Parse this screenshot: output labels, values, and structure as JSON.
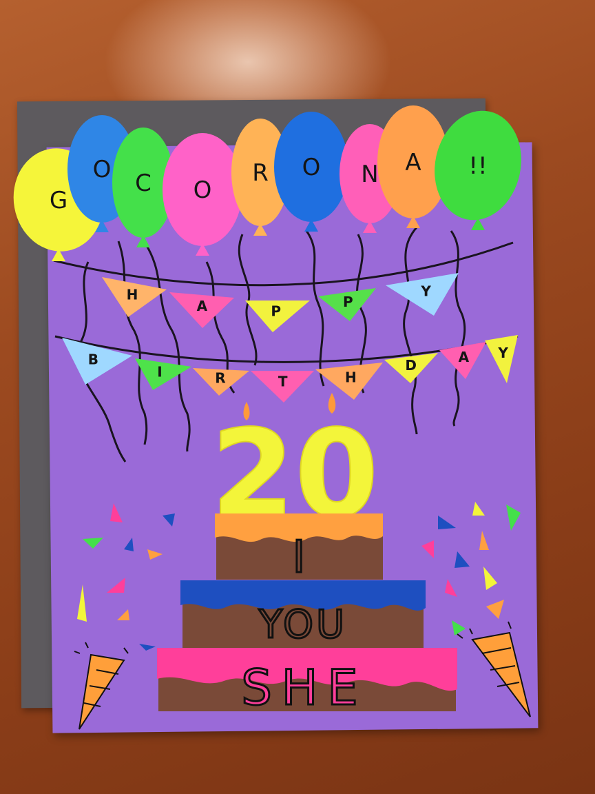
{
  "balloon_banner": {
    "letters": [
      "G",
      "O",
      "C",
      "O",
      "R",
      "O",
      "N",
      "A",
      "!!"
    ],
    "colors": [
      "#f5f53a",
      "#2f86e6",
      "#44e04a",
      "#ff62c8",
      "#ffb356",
      "#1f6fe0",
      "#ff5fb8",
      "#ffa04d",
      "#3fdc3f"
    ]
  },
  "bunting_row_1": {
    "letters": [
      "H",
      "A",
      "P",
      "P",
      "Y"
    ],
    "colors": [
      "#ffb46a",
      "#ff5fb0",
      "#f2f23e",
      "#56e04a",
      "#9fd8ff"
    ]
  },
  "bunting_row_2": {
    "letters": [
      "B",
      "I",
      "R",
      "T",
      "H",
      "D",
      "A",
      "Y"
    ],
    "colors": [
      "#9fd8ff",
      "#4ee24a",
      "#ffa860",
      "#ff5fb0",
      "#ffa860",
      "#f2f23e",
      "#ff5fb0",
      "#f2f23e"
    ]
  },
  "age_number": "20",
  "cake": {
    "top_tier_text": "I",
    "middle_tier_text": "YOU",
    "bottom_tier_text": "SHE",
    "colors": {
      "candle": "#f3f53a",
      "flame": "#ff9a3a",
      "top_icing": "#ffa040",
      "middle_icing": "#1e4fc0",
      "bottom_icing": "#ff3f9a",
      "sponge": "#7a4a38"
    }
  },
  "colors": {
    "paper_purple": "#9a6ad8",
    "backing_gray": "#5d5a5e",
    "wood": "#9c4a20"
  }
}
